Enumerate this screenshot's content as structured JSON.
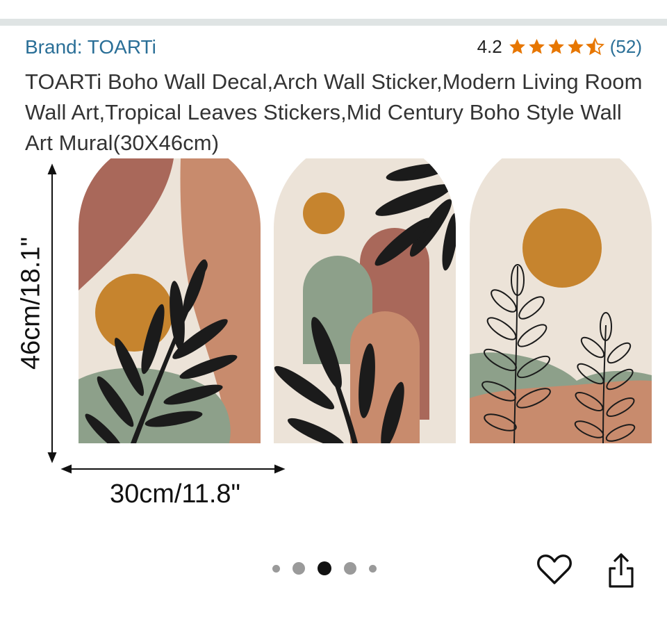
{
  "brand": {
    "label": "Brand: TOARTi"
  },
  "rating": {
    "value": "4.2",
    "stars_filled": 4.5,
    "count": "(52)",
    "star_color": "#e77600"
  },
  "product": {
    "title": "TOARTi Boho Wall Decal,Arch Wall Sticker,Modern Living Room Wall Art,Tropical Leaves Stickers,Mid Century Boho Style Wall Art Mural(30X46cm)"
  },
  "image": {
    "height_label": "46cm/18.1\"",
    "width_label": "30cm/11.8\"",
    "palette": {
      "cream": "#ece3d8",
      "terracotta": "#c88b6d",
      "rust": "#a9685a",
      "sage": "#8da08a",
      "ochre": "#c6842e",
      "black": "#1b1b1b"
    }
  },
  "carousel": {
    "total": 5,
    "active_index": 2
  },
  "actions": {
    "favorite_icon": "heart-icon",
    "share_icon": "share-icon"
  }
}
